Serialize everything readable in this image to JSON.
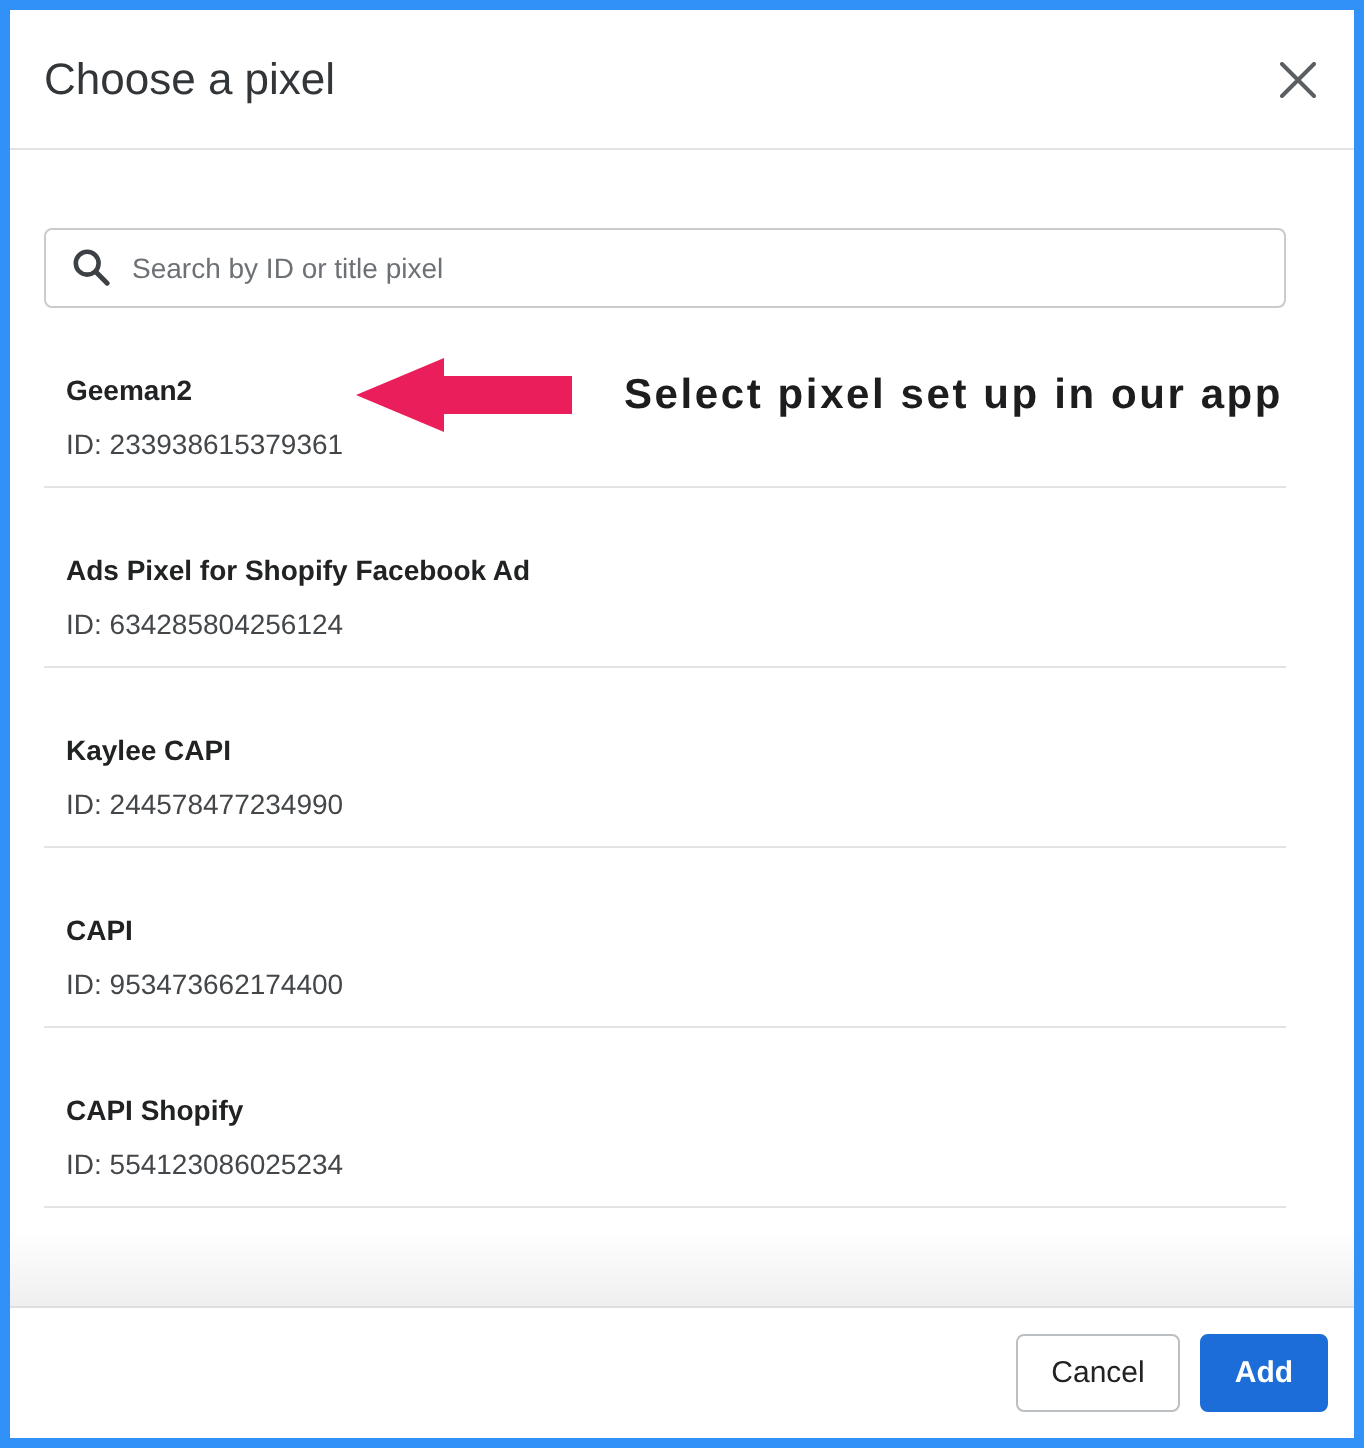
{
  "dialog": {
    "title": "Choose a pixel"
  },
  "search": {
    "placeholder": "Search by ID or title pixel"
  },
  "pixels": [
    {
      "name": "Geeman2",
      "id": "ID: 233938615379361"
    },
    {
      "name": "Ads Pixel for Shopify Facebook Ad",
      "id": "ID: 634285804256124"
    },
    {
      "name": "Kaylee CAPI",
      "id": "ID: 244578477234990"
    },
    {
      "name": "CAPI",
      "id": "ID: 953473662174400"
    },
    {
      "name": "CAPI Shopify",
      "id": "ID: 554123086025234"
    }
  ],
  "annotation": {
    "text": "Select pixel set up in our app"
  },
  "buttons": [
    {
      "label": "Cancel",
      "kind": "secondary"
    },
    {
      "label": "Add",
      "kind": "primary"
    }
  ]
}
